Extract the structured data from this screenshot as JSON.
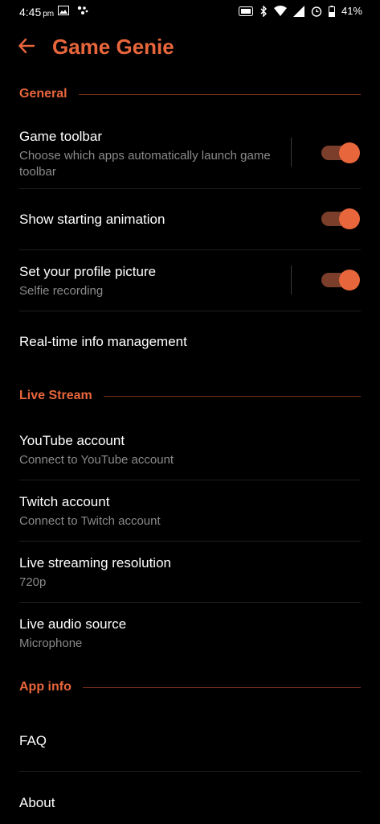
{
  "status_bar": {
    "time": "4:45",
    "ampm": "pm",
    "battery": "41%"
  },
  "app_bar": {
    "title": "Game Genie"
  },
  "sections": {
    "general": {
      "header": "General",
      "game_toolbar": {
        "title": "Game toolbar",
        "subtitle": "Choose which apps automatically launch game toolbar",
        "enabled": true
      },
      "starting_animation": {
        "title": "Show starting animation",
        "enabled": true
      },
      "profile_picture": {
        "title": "Set your profile picture",
        "subtitle": "Selfie recording",
        "enabled": true
      },
      "realtime_info": {
        "title": "Real-time info management"
      }
    },
    "live_stream": {
      "header": "Live Stream",
      "youtube": {
        "title": "YouTube account",
        "subtitle": "Connect to YouTube account"
      },
      "twitch": {
        "title": "Twitch account",
        "subtitle": "Connect to Twitch account"
      },
      "resolution": {
        "title": "Live streaming resolution",
        "subtitle": "720p"
      },
      "audio_source": {
        "title": "Live audio source",
        "subtitle": "Microphone"
      }
    },
    "app_info": {
      "header": "App info",
      "faq": {
        "title": "FAQ"
      },
      "about": {
        "title": "About"
      }
    }
  },
  "colors": {
    "accent": "#e8663c",
    "track": "#7a3e2b",
    "subtitle": "#8a8a8a"
  }
}
